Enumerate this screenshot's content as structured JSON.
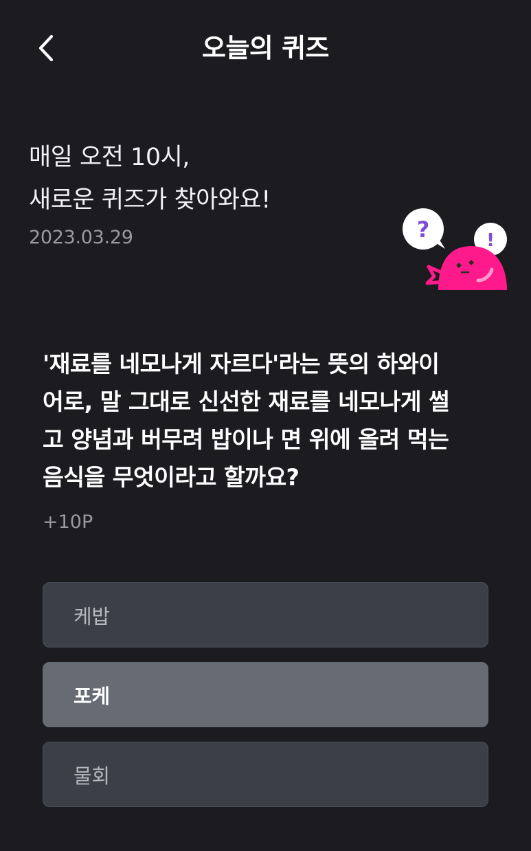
{
  "header": {
    "title": "오늘의 퀴즈",
    "back_icon": "chevron-left-icon"
  },
  "intro": {
    "line1": "매일 오전 10시,",
    "line2": "새로운 퀴즈가 찾아와요!",
    "date": "2023.03.29"
  },
  "mascot": {
    "question_mark": "?",
    "exclaim_mark": "!",
    "body_color": "#ff1a8c",
    "bubble_color": "#ffffff",
    "mark_color": "#7b4fd6"
  },
  "quiz": {
    "lines": [
      "'재료를 네모나게 자르다'라는 뜻의 하와이",
      "어로, 말 그대로 신선한 재료를 네모나게 썰",
      "고 양념과 버무려 밥이나 면 위에 올려 먹는",
      "음식을 무엇이라고 할까요?"
    ],
    "points": "+10P"
  },
  "options": [
    {
      "label": "케밥",
      "selected": false
    },
    {
      "label": "포케",
      "selected": true
    },
    {
      "label": "물회",
      "selected": false
    }
  ],
  "colors": {
    "background": "#1b1b20",
    "option_bg": "#3c3f48",
    "option_selected_bg": "#676b74",
    "muted_text": "#9a9aa2"
  }
}
